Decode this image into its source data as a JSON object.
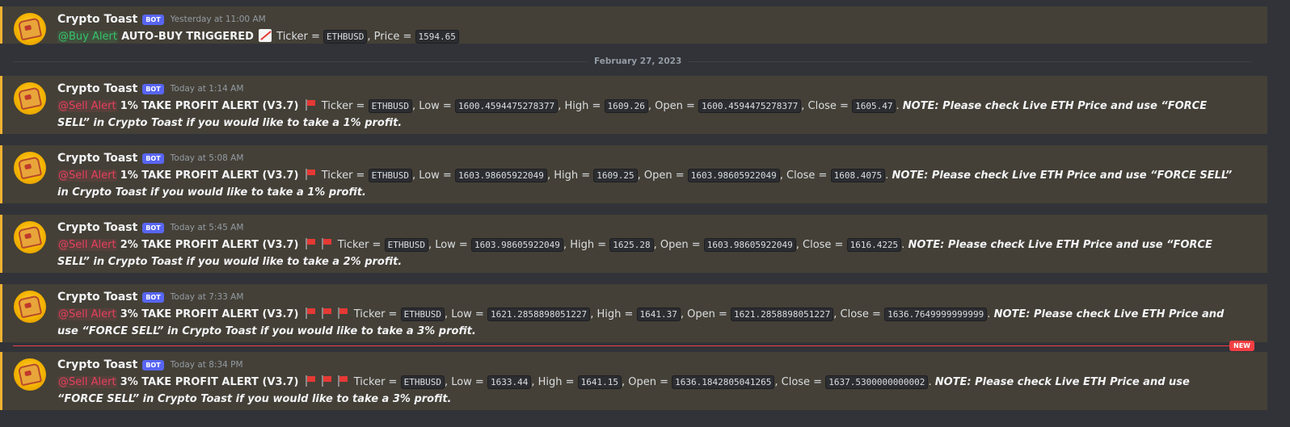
{
  "colors": {
    "background": "#313338",
    "highlight": "#444037",
    "accent_bar": "#f0b232",
    "bot_badge": "#5865f2",
    "buy_mention": "#35c46c",
    "sell_mention": "#e6405e",
    "new_marker": "#f23f43"
  },
  "bot_badge": "BOT",
  "date_divider": "February 27, 2023",
  "new_marker": "NEW",
  "messages": [
    {
      "author": "Crypto Toast",
      "timestamp": "Yesterday at 11:00 AM",
      "mention": "@Buy Alert",
      "title": "AUTO-BUY TRIGGERED",
      "icon": "chart-increasing-icon",
      "ticker_label": "Ticker =",
      "ticker": "ETHBUSD",
      "price_label": ", Price =",
      "price": "1594.65"
    },
    {
      "author": "Crypto Toast",
      "timestamp": "Today at 1:14 AM",
      "mention": "@Sell Alert",
      "title": "1% TAKE PROFIT ALERT (V3.7)",
      "flags": 1,
      "ticker_label": "Ticker =",
      "ticker": "ETHBUSD",
      "low_label": ", Low =",
      "low": "1600.4594475278377",
      "high_label": ", High =",
      "high": "1609.26",
      "open_label": ", Open =",
      "open": "1600.4594475278377",
      "close_label": ", Close =",
      "close": "1605.47",
      "note": "NOTE: Please check Live ETH Price and use “FORCE SELL” in Crypto Toast if you would like to take a 1% profit."
    },
    {
      "author": "Crypto Toast",
      "timestamp": "Today at 5:08 AM",
      "mention": "@Sell Alert",
      "title": "1% TAKE PROFIT ALERT (V3.7)",
      "flags": 1,
      "ticker_label": "Ticker =",
      "ticker": "ETHBUSD",
      "low_label": ", Low =",
      "low": "1603.98605922049",
      "high_label": ", High =",
      "high": "1609.25",
      "open_label": ", Open =",
      "open": "1603.98605922049",
      "close_label": ", Close =",
      "close": "1608.4075",
      "note": "NOTE: Please check Live ETH Price and use “FORCE SELL” in Crypto Toast if you would like to take a 1% profit."
    },
    {
      "author": "Crypto Toast",
      "timestamp": "Today at 5:45 AM",
      "mention": "@Sell Alert",
      "title": "2% TAKE PROFIT ALERT (V3.7)",
      "flags": 2,
      "ticker_label": "Ticker =",
      "ticker": "ETHBUSD",
      "low_label": ", Low =",
      "low": "1603.98605922049",
      "high_label": ", High =",
      "high": "1625.28",
      "open_label": ", Open =",
      "open": "1603.98605922049",
      "close_label": ", Close =",
      "close": "1616.4225",
      "note": "NOTE: Please check Live ETH Price and use “FORCE SELL” in Crypto Toast if you would like to take a 2% profit."
    },
    {
      "author": "Crypto Toast",
      "timestamp": "Today at 7:33 AM",
      "mention": "@Sell Alert",
      "title": "3% TAKE PROFIT ALERT (V3.7)",
      "flags": 3,
      "ticker_label": "Ticker =",
      "ticker": "ETHBUSD",
      "low_label": ", Low =",
      "low": "1621.2858898051227",
      "high_label": ", High =",
      "high": "1641.37",
      "open_label": ", Open =",
      "open": "1621.2858898051227",
      "close_label": ", Close =",
      "close": "1636.7649999999999",
      "note": "NOTE: Please check Live ETH Price and use “FORCE SELL” in Crypto Toast if you would like to take a 3% profit."
    },
    {
      "author": "Crypto Toast",
      "timestamp": "Today at 8:34 PM",
      "mention": "@Sell Alert",
      "title": "3% TAKE PROFIT ALERT (V3.7)",
      "flags": 3,
      "ticker_label": "Ticker =",
      "ticker": "ETHBUSD",
      "low_label": ", Low =",
      "low": "1633.44",
      "high_label": ", High =",
      "high": "1641.15",
      "open_label": ", Open =",
      "open": "1636.1842805041265",
      "close_label": ", Close =",
      "close": "1637.5300000000002",
      "note": "NOTE: Please check Live ETH Price and use “FORCE SELL” in Crypto Toast if you would like to take a 3% profit."
    }
  ]
}
